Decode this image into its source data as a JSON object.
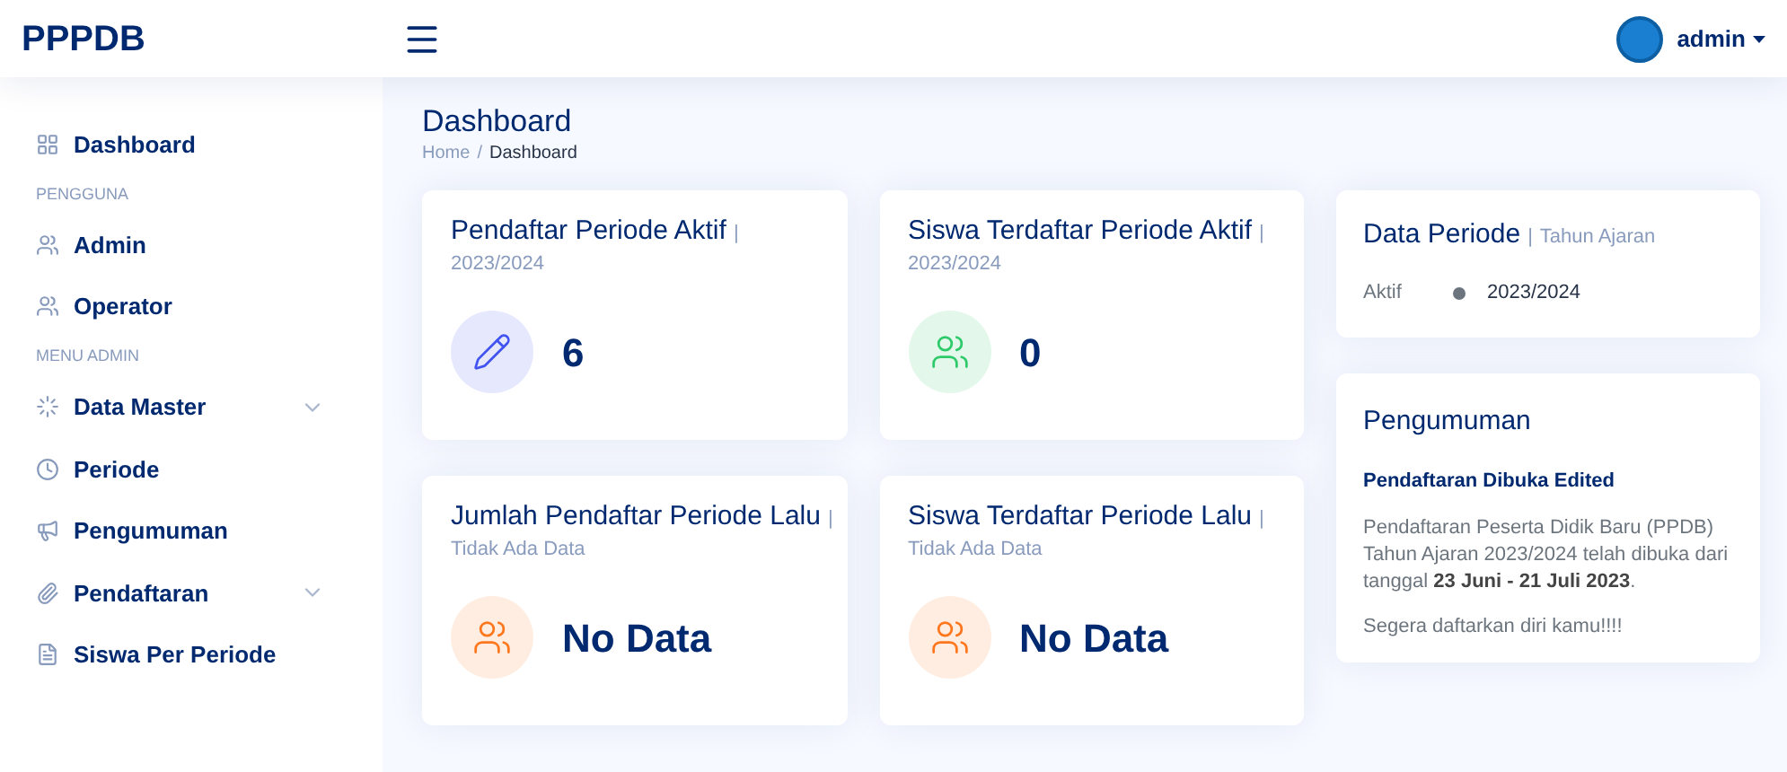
{
  "brand": "PPPDB",
  "user": {
    "name": "admin"
  },
  "sidebar": {
    "items": [
      {
        "kind": "link",
        "label": "Dashboard",
        "expandable": false
      },
      {
        "kind": "heading",
        "label": "PENGGUNA"
      },
      {
        "kind": "link",
        "label": "Admin",
        "expandable": false
      },
      {
        "kind": "link",
        "label": "Operator",
        "expandable": false
      },
      {
        "kind": "heading",
        "label": "MENU ADMIN"
      },
      {
        "kind": "link",
        "label": "Data Master",
        "expandable": true
      },
      {
        "kind": "link",
        "label": "Periode",
        "expandable": false
      },
      {
        "kind": "link",
        "label": "Pengumuman",
        "expandable": false
      },
      {
        "kind": "link",
        "label": "Pendaftaran",
        "expandable": true
      },
      {
        "kind": "link",
        "label": "Siswa Per Periode",
        "expandable": false
      }
    ]
  },
  "page": {
    "title": "Dashboard",
    "breadcrumb": [
      "Home",
      "Dashboard"
    ],
    "breadcrumb_separator": "/"
  },
  "stats": [
    {
      "title": "Pendaftar Periode Aktif",
      "separator": "|",
      "subtitle": "2023/2024",
      "value": "6",
      "color": "#4154f1"
    },
    {
      "title": "Siswa Terdaftar Periode Aktif",
      "separator": "|",
      "subtitle": "2023/2024",
      "value": "0",
      "color": "#2eca6a"
    },
    {
      "title": "Jumlah Pendaftar Periode Lalu",
      "separator": "|",
      "subtitle": "Tidak Ada Data",
      "value": "No Data",
      "color": "#ff771d"
    },
    {
      "title": "Siswa Terdaftar Periode Lalu",
      "separator": "|",
      "subtitle": "Tidak Ada Data",
      "value": "No Data",
      "color": "#ff771d"
    }
  ],
  "periode": {
    "title": "Data Periode",
    "separator": "|",
    "subtitle": "Tahun Ajaran",
    "rows": [
      {
        "label": "Aktif",
        "value": "2023/2024",
        "color": "#6c757d"
      }
    ]
  },
  "announcement": {
    "title": "Pengumuman",
    "heading": "Pendaftaran Dibuka Edited",
    "paragraphs": [
      "Pendaftaran Peserta Didik Baru (PPDB) Tahun Ajaran 2023/2024 telah dibuka dari tanggal **23 Juni - 21 Juli 2023**.",
      "Segera daftarkan diri kamu!!!!"
    ]
  }
}
